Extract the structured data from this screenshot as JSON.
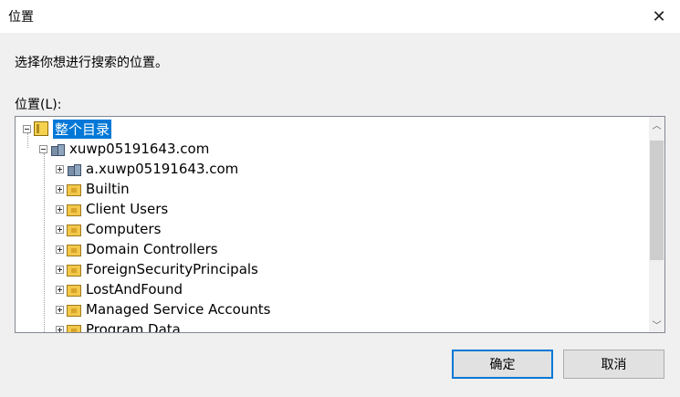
{
  "window": {
    "title": "位置",
    "close_glyph": "✕"
  },
  "prompt": "选择你想进行搜索的位置。",
  "location_label": "位置(L):",
  "tree": {
    "root": {
      "label": "整个目录",
      "icon": "directory-icon",
      "expanded": true,
      "selected": true
    },
    "domain": {
      "label": "xuwp05191643.com",
      "icon": "domain-icon",
      "expanded": true
    },
    "children": [
      {
        "label": "a.xuwp05191643.com",
        "icon": "domain-icon"
      },
      {
        "label": "Builtin",
        "icon": "folder-icon"
      },
      {
        "label": "Client Users",
        "icon": "folder-icon"
      },
      {
        "label": "Computers",
        "icon": "folder-icon"
      },
      {
        "label": "Domain Controllers",
        "icon": "folder-icon"
      },
      {
        "label": "ForeignSecurityPrincipals",
        "icon": "folder-icon"
      },
      {
        "label": "LostAndFound",
        "icon": "folder-icon"
      },
      {
        "label": "Managed Service Accounts",
        "icon": "folder-icon"
      },
      {
        "label": "Program Data",
        "icon": "folder-icon"
      }
    ]
  },
  "scrollbar": {
    "up_glyph": "︿",
    "down_glyph": "﹀"
  },
  "buttons": {
    "ok": "确定",
    "cancel": "取消"
  },
  "colors": {
    "selection": "#0078d7",
    "default_button_border": "#0078d7",
    "background": "#f0f0f0"
  }
}
